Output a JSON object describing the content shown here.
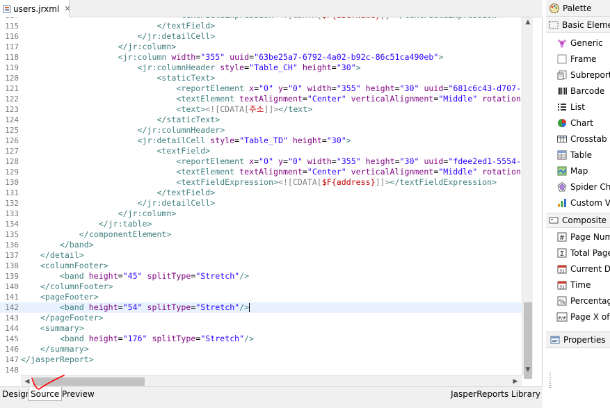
{
  "editor": {
    "tab_label": "users.jrxml",
    "tab_close": "✕",
    "lines": [
      {
        "num": "114",
        "indent": 32,
        "tokens": [
          {
            "t": "<",
            "c": "tag"
          },
          {
            "t": "textFieldExpression",
            "c": "tag"
          },
          {
            "t": "><![CDATA[",
            "c": "cdata"
          },
          {
            "t": "$F{userName}",
            "c": "expr"
          },
          {
            "t": "]]>",
            "c": "cdata"
          },
          {
            "t": "</textFieldExpression>",
            "c": "tag"
          }
        ]
      },
      {
        "num": "115",
        "indent": 28,
        "tokens": [
          {
            "t": "</textField>",
            "c": "tag"
          }
        ]
      },
      {
        "num": "116",
        "indent": 24,
        "tokens": [
          {
            "t": "</jr:detailCell>",
            "c": "tag"
          }
        ]
      },
      {
        "num": "117",
        "indent": 20,
        "tokens": [
          {
            "t": "</jr:column>",
            "c": "tag"
          }
        ]
      },
      {
        "num": "118",
        "indent": 20,
        "tokens": [
          {
            "t": "<jr:column ",
            "c": "tag"
          },
          {
            "t": "width",
            "c": "attr"
          },
          {
            "t": "=",
            "c": ""
          },
          {
            "t": "\"355\"",
            "c": "val"
          },
          {
            "t": " uuid",
            "c": "attr"
          },
          {
            "t": "=",
            "c": ""
          },
          {
            "t": "\"63be25a7-6792-4a02-b92c-86c51ca490eb\"",
            "c": "val"
          },
          {
            "t": ">",
            "c": "tag"
          }
        ]
      },
      {
        "num": "119",
        "indent": 24,
        "tokens": [
          {
            "t": "<jr:columnHeader ",
            "c": "tag"
          },
          {
            "t": "style",
            "c": "attr"
          },
          {
            "t": "=",
            "c": ""
          },
          {
            "t": "\"Table_CH\"",
            "c": "val"
          },
          {
            "t": " height",
            "c": "attr"
          },
          {
            "t": "=",
            "c": ""
          },
          {
            "t": "\"30\"",
            "c": "val"
          },
          {
            "t": ">",
            "c": "tag"
          }
        ]
      },
      {
        "num": "120",
        "indent": 28,
        "tokens": [
          {
            "t": "<staticText>",
            "c": "tag"
          }
        ]
      },
      {
        "num": "121",
        "indent": 32,
        "tokens": [
          {
            "t": "<reportElement ",
            "c": "tag"
          },
          {
            "t": "x",
            "c": "attr"
          },
          {
            "t": "=",
            "c": ""
          },
          {
            "t": "\"0\"",
            "c": "val"
          },
          {
            "t": " y",
            "c": "attr"
          },
          {
            "t": "=",
            "c": ""
          },
          {
            "t": "\"0\"",
            "c": "val"
          },
          {
            "t": " width",
            "c": "attr"
          },
          {
            "t": "=",
            "c": ""
          },
          {
            "t": "\"355\"",
            "c": "val"
          },
          {
            "t": " height",
            "c": "attr"
          },
          {
            "t": "=",
            "c": ""
          },
          {
            "t": "\"30\"",
            "c": "val"
          },
          {
            "t": " uuid",
            "c": "attr"
          },
          {
            "t": "=",
            "c": ""
          },
          {
            "t": "\"681c6c43-d707-",
            "c": "val"
          }
        ]
      },
      {
        "num": "122",
        "indent": 32,
        "tokens": [
          {
            "t": "<textElement ",
            "c": "tag"
          },
          {
            "t": "textAlignment",
            "c": "attr"
          },
          {
            "t": "=",
            "c": ""
          },
          {
            "t": "\"Center\"",
            "c": "val"
          },
          {
            "t": " verticalAlignment",
            "c": "attr"
          },
          {
            "t": "=",
            "c": ""
          },
          {
            "t": "\"Middle\"",
            "c": "val"
          },
          {
            "t": " rotation",
            "c": "attr"
          }
        ]
      },
      {
        "num": "123",
        "indent": 32,
        "tokens": [
          {
            "t": "<text>",
            "c": "tag"
          },
          {
            "t": "<![CDATA[",
            "c": "cdata"
          },
          {
            "t": "주소",
            "c": "expr"
          },
          {
            "t": "]]>",
            "c": "cdata"
          },
          {
            "t": "</text>",
            "c": "tag"
          }
        ]
      },
      {
        "num": "124",
        "indent": 28,
        "tokens": [
          {
            "t": "</staticText>",
            "c": "tag"
          }
        ]
      },
      {
        "num": "125",
        "indent": 24,
        "tokens": [
          {
            "t": "</jr:columnHeader>",
            "c": "tag"
          }
        ]
      },
      {
        "num": "126",
        "indent": 24,
        "tokens": [
          {
            "t": "<jr:detailCell ",
            "c": "tag"
          },
          {
            "t": "style",
            "c": "attr"
          },
          {
            "t": "=",
            "c": ""
          },
          {
            "t": "\"Table_TD\"",
            "c": "val"
          },
          {
            "t": " height",
            "c": "attr"
          },
          {
            "t": "=",
            "c": ""
          },
          {
            "t": "\"30\"",
            "c": "val"
          },
          {
            "t": ">",
            "c": "tag"
          }
        ]
      },
      {
        "num": "127",
        "indent": 28,
        "tokens": [
          {
            "t": "<textField>",
            "c": "tag"
          }
        ]
      },
      {
        "num": "128",
        "indent": 32,
        "tokens": [
          {
            "t": "<reportElement ",
            "c": "tag"
          },
          {
            "t": "x",
            "c": "attr"
          },
          {
            "t": "=",
            "c": ""
          },
          {
            "t": "\"0\"",
            "c": "val"
          },
          {
            "t": " y",
            "c": "attr"
          },
          {
            "t": "=",
            "c": ""
          },
          {
            "t": "\"0\"",
            "c": "val"
          },
          {
            "t": " width",
            "c": "attr"
          },
          {
            "t": "=",
            "c": ""
          },
          {
            "t": "\"355\"",
            "c": "val"
          },
          {
            "t": " height",
            "c": "attr"
          },
          {
            "t": "=",
            "c": ""
          },
          {
            "t": "\"30\"",
            "c": "val"
          },
          {
            "t": " uuid",
            "c": "attr"
          },
          {
            "t": "=",
            "c": ""
          },
          {
            "t": "\"fdee2ed1-5554-",
            "c": "val"
          }
        ]
      },
      {
        "num": "129",
        "indent": 32,
        "tokens": [
          {
            "t": "<textElement ",
            "c": "tag"
          },
          {
            "t": "textAlignment",
            "c": "attr"
          },
          {
            "t": "=",
            "c": ""
          },
          {
            "t": "\"Center\"",
            "c": "val"
          },
          {
            "t": " verticalAlignment",
            "c": "attr"
          },
          {
            "t": "=",
            "c": ""
          },
          {
            "t": "\"Middle\"",
            "c": "val"
          },
          {
            "t": " rotation",
            "c": "attr"
          }
        ]
      },
      {
        "num": "130",
        "indent": 32,
        "tokens": [
          {
            "t": "<textFieldExpression>",
            "c": "tag"
          },
          {
            "t": "<![CDATA[",
            "c": "cdata"
          },
          {
            "t": "$F{address}",
            "c": "expr"
          },
          {
            "t": "]]>",
            "c": "cdata"
          },
          {
            "t": "</textFieldExpression>",
            "c": "tag"
          }
        ]
      },
      {
        "num": "131",
        "indent": 28,
        "tokens": [
          {
            "t": "</textField>",
            "c": "tag"
          }
        ]
      },
      {
        "num": "132",
        "indent": 24,
        "tokens": [
          {
            "t": "</jr:detailCell>",
            "c": "tag"
          }
        ]
      },
      {
        "num": "133",
        "indent": 20,
        "tokens": [
          {
            "t": "</jr:column>",
            "c": "tag"
          }
        ]
      },
      {
        "num": "134",
        "indent": 16,
        "tokens": [
          {
            "t": "</jr:table>",
            "c": "tag"
          }
        ]
      },
      {
        "num": "135",
        "indent": 12,
        "tokens": [
          {
            "t": "</componentElement>",
            "c": "tag"
          }
        ]
      },
      {
        "num": "136",
        "indent": 8,
        "tokens": [
          {
            "t": "</band>",
            "c": "tag"
          }
        ]
      },
      {
        "num": "137",
        "indent": 4,
        "tokens": [
          {
            "t": "</detail>",
            "c": "tag"
          }
        ]
      },
      {
        "num": "138",
        "indent": 4,
        "tokens": [
          {
            "t": "<columnFooter>",
            "c": "tag"
          }
        ]
      },
      {
        "num": "139",
        "indent": 8,
        "tokens": [
          {
            "t": "<band ",
            "c": "tag"
          },
          {
            "t": "height",
            "c": "attr"
          },
          {
            "t": "=",
            "c": ""
          },
          {
            "t": "\"45\"",
            "c": "val"
          },
          {
            "t": " splitType",
            "c": "attr"
          },
          {
            "t": "=",
            "c": ""
          },
          {
            "t": "\"Stretch\"",
            "c": "val"
          },
          {
            "t": "/>",
            "c": "tag"
          }
        ]
      },
      {
        "num": "140",
        "indent": 4,
        "tokens": [
          {
            "t": "</columnFooter>",
            "c": "tag"
          }
        ]
      },
      {
        "num": "141",
        "indent": 4,
        "tokens": [
          {
            "t": "<pageFooter>",
            "c": "tag"
          }
        ]
      },
      {
        "num": "142",
        "indent": 8,
        "current": true,
        "tokens": [
          {
            "t": "<band ",
            "c": "tag"
          },
          {
            "t": "height",
            "c": "attr"
          },
          {
            "t": "=",
            "c": ""
          },
          {
            "t": "\"54\"",
            "c": "val"
          },
          {
            "t": " splitType",
            "c": "attr"
          },
          {
            "t": "=",
            "c": ""
          },
          {
            "t": "\"Stretch\"",
            "c": "val"
          },
          {
            "t": "/>",
            "c": "tag"
          }
        ]
      },
      {
        "num": "143",
        "indent": 4,
        "tokens": [
          {
            "t": "</pageFooter>",
            "c": "tag"
          }
        ]
      },
      {
        "num": "144",
        "indent": 4,
        "tokens": [
          {
            "t": "<summary>",
            "c": "tag"
          }
        ]
      },
      {
        "num": "145",
        "indent": 8,
        "tokens": [
          {
            "t": "<band ",
            "c": "tag"
          },
          {
            "t": "height",
            "c": "attr"
          },
          {
            "t": "=",
            "c": ""
          },
          {
            "t": "\"176\"",
            "c": "val"
          },
          {
            "t": " splitType",
            "c": "attr"
          },
          {
            "t": "=",
            "c": ""
          },
          {
            "t": "\"Stretch\"",
            "c": "val"
          },
          {
            "t": "/>",
            "c": "tag"
          }
        ]
      },
      {
        "num": "146",
        "indent": 4,
        "tokens": [
          {
            "t": "</summary>",
            "c": "tag"
          }
        ]
      },
      {
        "num": "147",
        "indent": 0,
        "tokens": [
          {
            "t": "</jasperReport>",
            "c": "tag"
          }
        ]
      },
      {
        "num": "148",
        "indent": 0,
        "tokens": []
      }
    ]
  },
  "bottom_tabs": {
    "design": "Design",
    "source": "Source",
    "preview": "Preview",
    "library": "JasperReports Library"
  },
  "palette": {
    "title": "Palette",
    "group_basic": "Basic Elements",
    "basic_items": [
      {
        "label": "Generic",
        "icon": "generic-icon"
      },
      {
        "label": "Frame",
        "icon": "frame-icon"
      },
      {
        "label": "Subreport",
        "icon": "subreport-icon"
      },
      {
        "label": "Barcode",
        "icon": "barcode-icon"
      },
      {
        "label": "List",
        "icon": "list-icon"
      },
      {
        "label": "Chart",
        "icon": "chart-icon"
      },
      {
        "label": "Crosstab",
        "icon": "crosstab-icon"
      },
      {
        "label": "Table",
        "icon": "table-icon"
      },
      {
        "label": "Map",
        "icon": "map-icon"
      },
      {
        "label": "Spider Chart",
        "icon": "spider-chart-icon"
      },
      {
        "label": "Custom Visualization",
        "icon": "custom-visualization-icon"
      }
    ],
    "group_composite": "Composite Elements",
    "composite_items": [
      {
        "label": "Page Number",
        "icon": "page-number-icon"
      },
      {
        "label": "Total Pages",
        "icon": "total-pages-icon"
      },
      {
        "label": "Current Date",
        "icon": "current-date-icon"
      },
      {
        "label": "Time",
        "icon": "time-icon"
      },
      {
        "label": "Percentage",
        "icon": "percentage-icon"
      },
      {
        "label": "Page X of Y",
        "icon": "page-x-of-y-icon"
      }
    ]
  },
  "properties": {
    "title": "Properties"
  },
  "colors": {
    "tag": "#3f7f7f",
    "attr": "#7f007f",
    "value": "#2a00ff",
    "cdata": "#808080",
    "expr": "#c00000",
    "current_line": "#e8f2fe",
    "annotation": "#ff0000"
  }
}
